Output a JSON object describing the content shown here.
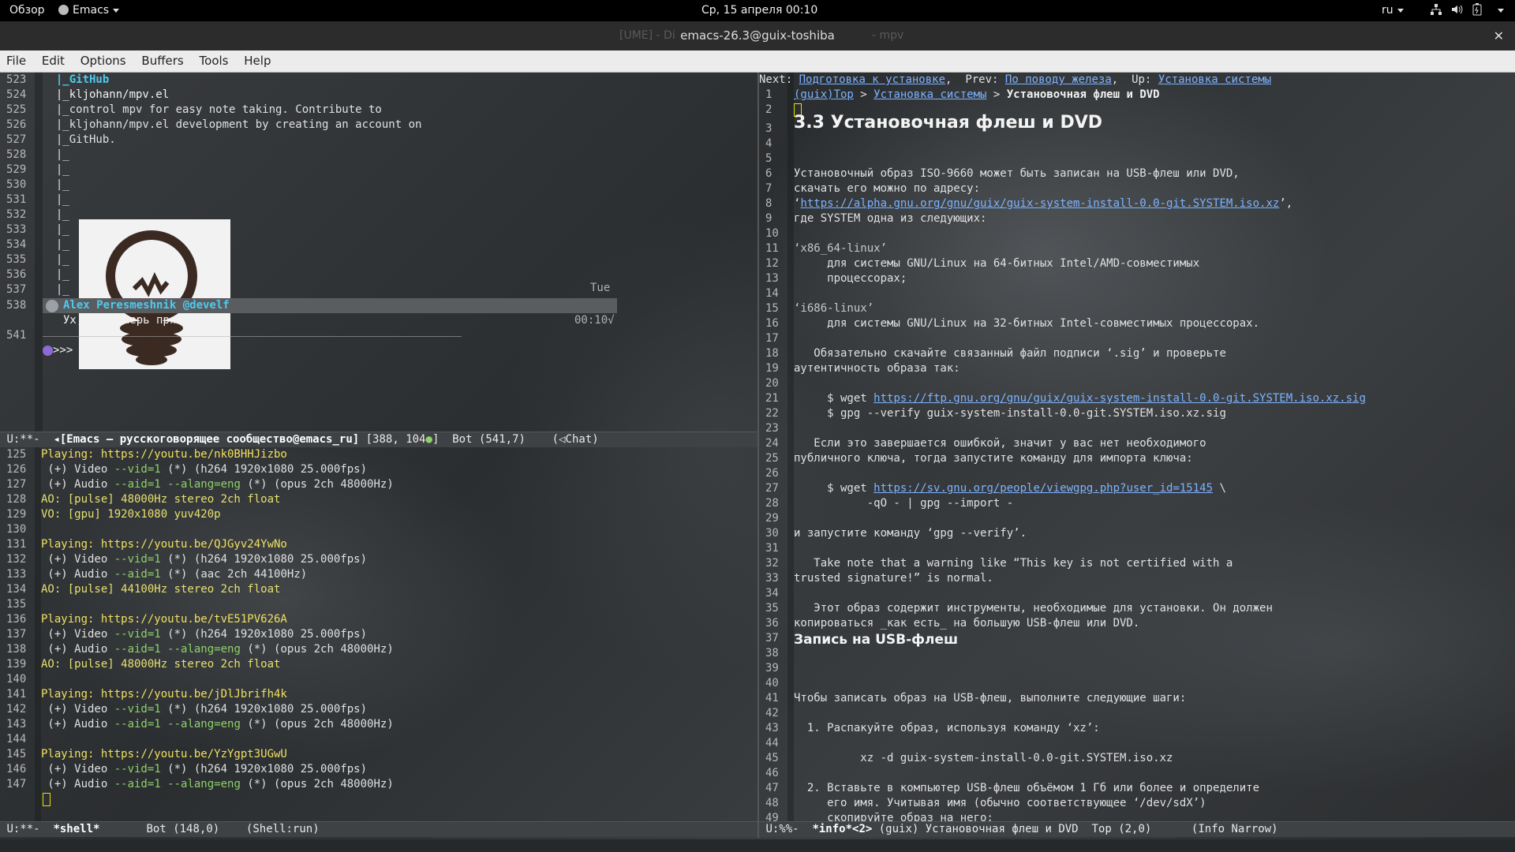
{
  "topbar": {
    "activities": "Обзор",
    "app": "Emacs",
    "clock": "Ср, 15 апреля  00:10",
    "lang": "ru"
  },
  "titlebar": {
    "title": "emacs-26.3@guix-toshiba",
    "ghost_left": "[UME] - Di",
    "ghost_right": "- mpv"
  },
  "menu": [
    "File",
    "Edit",
    "Options",
    "Buffers",
    "Tools",
    "Help"
  ],
  "chat": {
    "lines": [
      {
        "n": "523",
        "text": "  |_GitHub",
        "cls": "cyanbold"
      },
      {
        "n": "524",
        "text": "  |_kljohann/mpv.el",
        "cls": "white"
      },
      {
        "n": "525",
        "text": "  |_control mpv for easy note taking. Contribute to",
        "cls": ""
      },
      {
        "n": "526",
        "text": "  |_kljohann/mpv.el development by creating an account on",
        "cls": ""
      },
      {
        "n": "527",
        "text": "  |_GitHub.",
        "cls": ""
      },
      {
        "n": "528",
        "text": "  |_",
        "cls": ""
      },
      {
        "n": "529",
        "text": "  |_",
        "cls": ""
      },
      {
        "n": "530",
        "text": "  |_",
        "cls": ""
      },
      {
        "n": "531",
        "text": "  |_",
        "cls": ""
      },
      {
        "n": "532",
        "text": "  |_",
        "cls": ""
      },
      {
        "n": "533",
        "text": "  |_",
        "cls": ""
      },
      {
        "n": "534",
        "text": "  |_",
        "cls": ""
      },
      {
        "n": "535",
        "text": "  |_",
        "cls": ""
      },
      {
        "n": "536",
        "text": "  |_",
        "cls": ""
      },
      {
        "n": "537",
        "text": "  |_",
        "cls": ""
      }
    ],
    "day": "Tue",
    "author_line_no": "538",
    "author": "Alex Peresmeshnik @develf",
    "message": "Ух, ну теперь прям ништяк",
    "time": "00:10√",
    "prompt_line_no": "541",
    "separator": "_______________________________________________________________",
    "prompt": ">>>"
  },
  "chat_modeline": {
    "status": "U:**-",
    "buffer": "◂[Emacs — русскоговорящее сообщество@emacs_ru]",
    "pos": "[388",
    "pos2": ", 104",
    "pos_end": "]",
    "where": "Bot (541,7)",
    "mode": "(◁Chat)"
  },
  "shell": {
    "lines": [
      {
        "n": "125",
        "text": "Playing: https://youtu.be/nk0BHHJizbo",
        "kind": "playing"
      },
      {
        "n": "126",
        "video": true
      },
      {
        "n": "127",
        "audio": "opus 2ch 48000Hz",
        "lang": true
      },
      {
        "n": "128",
        "text": "AO: [pulse] 48000Hz stereo 2ch float",
        "kind": "ao"
      },
      {
        "n": "129",
        "text": "VO: [gpu] 1920x1080 yuv420p",
        "kind": "ao"
      },
      {
        "n": "130",
        "text": "",
        "kind": ""
      },
      {
        "n": "131",
        "text": "Playing: https://youtu.be/QJGyv24YwNo",
        "kind": "playing"
      },
      {
        "n": "132",
        "video": true
      },
      {
        "n": "133",
        "audio": "aac 2ch 44100Hz",
        "lang": false
      },
      {
        "n": "134",
        "text": "AO: [pulse] 44100Hz stereo 2ch float",
        "kind": "ao"
      },
      {
        "n": "135",
        "text": "",
        "kind": ""
      },
      {
        "n": "136",
        "text": "Playing: https://youtu.be/tvE51PV626A",
        "kind": "playing"
      },
      {
        "n": "137",
        "video": true
      },
      {
        "n": "138",
        "audio": "opus 2ch 48000Hz",
        "lang": true
      },
      {
        "n": "139",
        "text": "AO: [pulse] 48000Hz stereo 2ch float",
        "kind": "ao"
      },
      {
        "n": "140",
        "text": "",
        "kind": ""
      },
      {
        "n": "141",
        "text": "Playing: https://youtu.be/jDlJbrifh4k",
        "kind": "playing"
      },
      {
        "n": "142",
        "video": true
      },
      {
        "n": "143",
        "audio": "opus 2ch 48000Hz",
        "lang": true
      },
      {
        "n": "144",
        "text": "",
        "kind": ""
      },
      {
        "n": "145",
        "text": "Playing: https://youtu.be/YzYgpt3UGwU",
        "kind": "playing"
      },
      {
        "n": "146",
        "video": true
      },
      {
        "n": "147",
        "audio": "opus 2ch 48000Hz",
        "lang": true
      }
    ],
    "video_prefix": " (+) Video ",
    "vid_flag": "--vid=1",
    "video_suffix": " (*) (h264 1920x1080 25.000fps)",
    "audio_prefix": " (+) Audio ",
    "aid_flag": "--aid=1",
    "alang_flag": " --alang=eng",
    "audio_mid": " (*) ("
  },
  "shell_modeline": {
    "status": "U:**-",
    "buffer": "*shell*",
    "where": "Bot (148,0)",
    "mode": "(Shell:run)"
  },
  "info": {
    "nav": {
      "next_label": "Next:",
      "next": "Подготовка к установке",
      "prev_label": "Prev:",
      "prev": "По поводу железа",
      "up_label": "Up:",
      "up": "Установка системы"
    },
    "crumb": {
      "top": "(guix)Top",
      "mid": "Установка системы",
      "sep": " > ",
      "current": "Установочная флеш и DVD"
    },
    "heading": "3.3 Установочная флеш и DVD",
    "subheading": "Запись на USB-флеш",
    "lines": {
      "6": "Установочный образ ISO-9660 может быть записан на USB-флеш или DVD,",
      "7": "скачать его можно по адресу:",
      "8_pre": "‘",
      "8_link": "https://alpha.gnu.org/gnu/guix/guix-system-install-0.0-git.SYSTEM.iso.xz",
      "8_post": "’,",
      "9": "где SYSTEM одна из следующих:",
      "11": "‘x86_64-linux’",
      "12": "     для системы GNU/Linux на 64-битных Intel/AMD-совместимых",
      "13": "     процессорах;",
      "15": "‘i686-linux’",
      "16": "     для системы GNU/Linux на 32-битных Intel-совместимых процессорах.",
      "18": "   Обязательно скачайте связанный файл подписи ‘.sig’ и проверьте",
      "19": "аутентичность образа так:",
      "21_pre": "     $ wget ",
      "21_link": "https://ftp.gnu.org/gnu/guix/guix-system-install-0.0-git.SYSTEM.iso.xz.sig",
      "22": "     $ gpg --verify guix-system-install-0.0-git.SYSTEM.iso.xz.sig",
      "24": "   Если это завершается ошибкой, значит у вас нет необходимого",
      "25": "публичного ключа, тогда запустите команду для импорта ключа:",
      "27_pre": "     $ wget ",
      "27_link": "https://sv.gnu.org/people/viewgpg.php?user_id=15145",
      "27_post": " \\",
      "28": "           -qO - | gpg --import -",
      "30": "и запустите команду ‘gpg --verify’.",
      "32": "   Take note that a warning like “This key is not certified with a",
      "33": "trusted signature!” is normal.",
      "35": "   Этот образ содержит инструменты, необходимые для установки. Он должен",
      "36": "копироваться _как есть_ на большую USB-флеш или DVD.",
      "41": "Чтобы записать образ на USB-флеш, выполните следующие шаги:",
      "43": "  1. Распакуйте образ, используя команду ‘xz’:",
      "45": "          xz -d guix-system-install-0.0-git.SYSTEM.iso.xz",
      "47": "  2. Вставьте в компьютер USB-флеш объёмом 1 Гб или более и определите",
      "48": "     его имя. Учитывая имя (обычно соответствующее ‘/dev/sdX’)",
      "49": "     скопируйте образ на него:"
    }
  },
  "info_modeline": {
    "status": "U:%%-",
    "buffer": "*info*<2>",
    "node": "(guix) Установочная флеш и DVD",
    "where": "Top (2,0)",
    "mode": "(Info Narrow)"
  }
}
